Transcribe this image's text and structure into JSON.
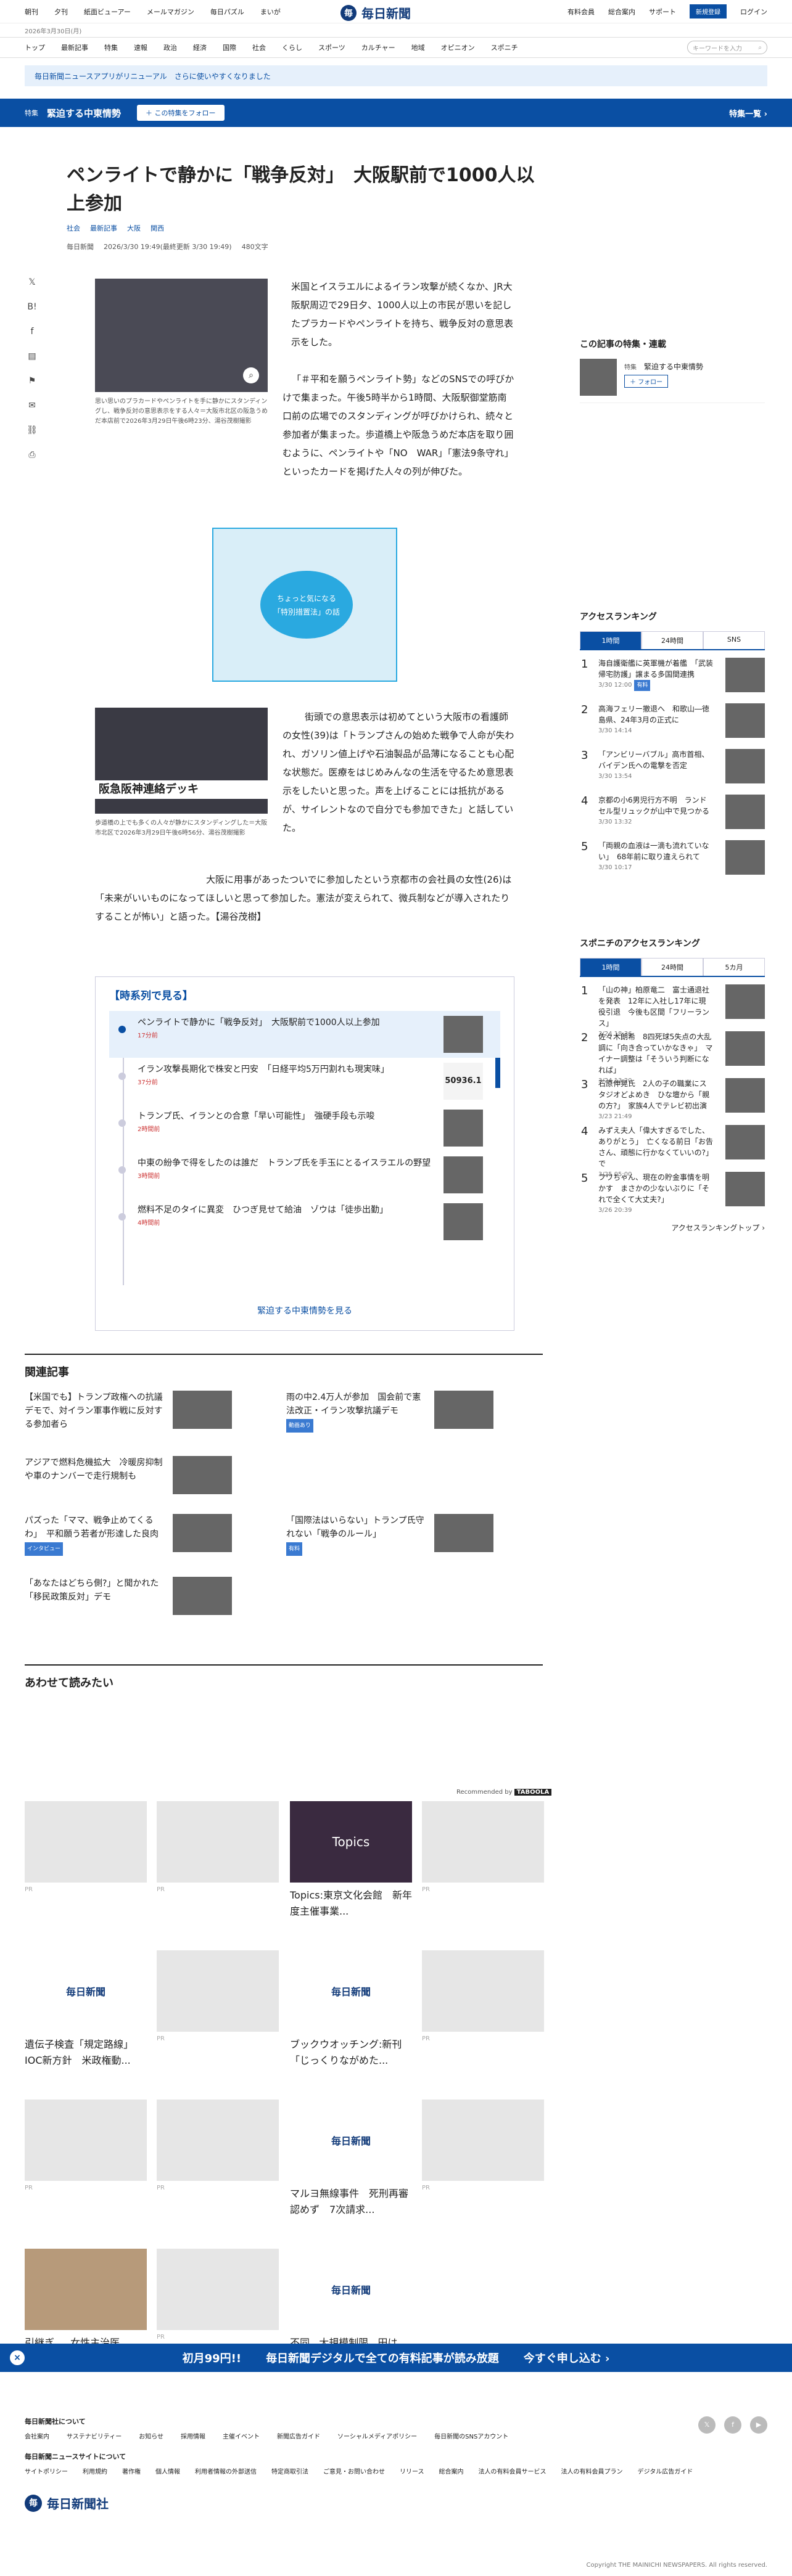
{
  "header": {
    "left_links": [
      "朝刊",
      "夕刊",
      "紙面ビューアー",
      "メールマガジン",
      "毎日パズル",
      "まいが"
    ],
    "logo_text": "毎日新聞",
    "right_links": [
      "有料会員",
      "総合案内",
      "サポート"
    ],
    "register_label": "新規登録",
    "login_label": "ログイン",
    "date": "2026年3月30日(月)"
  },
  "nav": {
    "items": [
      "トップ",
      "最新記事",
      "特集",
      "速報",
      "政治",
      "経済",
      "国際",
      "社会",
      "くらし",
      "スポーツ",
      "カルチャー",
      "地域",
      "オピニオン",
      "スポニチ"
    ],
    "search_placeholder": "キーワードを入力"
  },
  "notice": "毎日新聞ニュースアプリがリニューアル　さらに使いやすくなりました",
  "feature": {
    "tag": "特集",
    "title": "緊迫する中東情勢",
    "follow_label": "この特集をフォロー",
    "list_label": "特集一覧"
  },
  "article": {
    "title": "ペンライトで静かに「戦争反対」　大阪駅前で1000人以上参加",
    "tags": [
      "社会",
      "最新記事",
      "大阪",
      "関西"
    ],
    "author": "毎日新聞",
    "time": "2026/3/30 19:49(最終更新 3/30 19:49)",
    "length": "480文字",
    "caption1": "思い思いのプラカードやペンライトを手に静かにスタンディングし、戦争反対の意思表示をする人々＝大阪市北区の阪急うめだ本店前で2026年3月29日午後6時23分、湯谷茂樹撮影",
    "caption2": "歩道橋の上でも多くの人々が静かにスタンディングした＝大阪市北区で2026年3月29日午後6時56分、湯谷茂樹撮影",
    "p1": "米国とイスラエルによるイラン攻撃が続くなか、JR大阪駅周辺で29日夕、1000人以上の市民が思いを記したプラカードやペンライトを持ち、戦争反対の意思表示をした。",
    "p2": "「＃平和を願うペンライト勢」などのSNSでの呼びかけで集まった。午後5時半から1時間、大阪駅御堂筋南口前の広場でのスタンディングが呼びかけられ、続々と参加者が集まった。歩道橋上や阪急うめだ本店を取り囲むように、ペンライトや「NO　WAR」「憲法9条守れ」といったカードを掲げた人々の列が伸びた。",
    "p3": "街頭での意思表示は初めてという大阪市の看護師の女性(39)は「トランプさんの始めた戦争で人命が失われ、ガソリン値上げや石油製品が品薄になることも心配な状態だ。医療をはじめみんなの生活を守るため意思表示をしたいと思った。声を上げることには抵抗があるが、サイレントなので自分でも参加できた」と話していた。",
    "p4": "大阪に用事があったついでに参加したという京都市の会社員の女性(26)は「未来がいいものになってほしいと思って参加した。憲法が変えられて、微兵制などが導入されたりすることが怖い」と語った。【湯谷茂樹】",
    "promo_lines": [
      "ちょっと気になる",
      "「特別措置法」の話"
    ],
    "photo_sign": "阪急阪神連絡デッキ"
  },
  "timeline": {
    "title": "【時系列で見る】",
    "items": [
      {
        "title": "ペンライトで静かに「戦争反対」　大阪駅前で1000人以上参加",
        "date": "17分前"
      },
      {
        "title": "イラン攻撃長期化で株安と円安　「日経平均5万円割れも現実味」",
        "date": "37分前"
      },
      {
        "title": "トランプ氏、イランとの合意「早い可能性」　強硬手段も示唆",
        "date": "2時間前"
      },
      {
        "title": "中東の紛争で得をしたのは誰だ　トランプ氏を手玉にとるイスラエルの野望",
        "date": "3時間前"
      },
      {
        "title": "燃料不足のタイに異変　ひつぎ見せて給油　ゾウは「徒歩出勤」",
        "date": "4時間前"
      }
    ],
    "thumb_text": "50936.1",
    "more": "緊迫する中東情勢を見る"
  },
  "related": {
    "title": "関連記事",
    "items": [
      {
        "title": "【米国でも】トランプ政権への抗議デモで、対イラン軍事作戦に反対する参加者ら"
      },
      {
        "title": "雨の中2.4万人が参加　国会前で憲法改正・イラン攻撃抗議デモ",
        "badge": "動画あり"
      },
      {
        "title": "アジアで燃料危機拡大　冷暖房抑制や車のナンバーで走行規制も"
      },
      {
        "title": "パズった「ママ、戦争止めてくるわ」　平和願う若者が形達した良肉",
        "badge": "インタビュー"
      },
      {
        "title": "「国際法はいらない」トランプ氏守れない「戦争のルール」",
        "badge": "有料"
      },
      {
        "title": "「あなたはどちら側?」と聞かれた「移民政策反対」デモ"
      }
    ]
  },
  "recommend": {
    "title": "あわせて読みたい",
    "by": "Recommended by",
    "brand": "TABOOLA",
    "pr": "PR",
    "topics_label": "Topics",
    "cards": [
      "Topics:東京文化会館　新年度主催事業...",
      "遺伝子検査「規定路線」IOC新方針　米政権動...",
      "ブックウオッチング:新刊　「じっくりながめた...",
      "マルヨ無線事件　死刑再審認めず　7次請求...",
      "引継ぎ..　女性主治医...",
      "不同...大規模制限...田は..."
    ]
  },
  "sidebar": {
    "series_title": "この記事の特集・連載",
    "series_tag": "特集",
    "series_name": "緊迫する中東情勢",
    "series_follow": "フォロー",
    "access_title": "アクセスランキング",
    "tabs": [
      "1時間",
      "24時間",
      "SNS"
    ],
    "ranking": [
      {
        "title": "海自護衛艦に英軍機が着艦　「武装帰宅防護」譲まる多国間連携",
        "date": "3/30 12:00",
        "badge": "有料"
      },
      {
        "title": "高海フェリー撤退へ　和歌山―徳島県、24年3月の正式に",
        "date": "3/30 14:14"
      },
      {
        "title": "「アンビリーバブル」高市首相、バイデン氏への電撃を否定",
        "date": "3/30 13:54"
      },
      {
        "title": "京都の小6男児行方不明　ランドセル型リュックが山中で見つかる",
        "date": "3/30 13:32"
      },
      {
        "title": "「両親の血液は一滴も流れていない」　68年前に取り違えられて",
        "date": "3/30 10:17"
      }
    ],
    "sponichi_title": "スポニチのアクセスランキング",
    "sponichi_tabs": [
      "1時間",
      "24時間",
      "5カ月"
    ],
    "sponichi": [
      {
        "title": "「山の神」柏原竜二　富士通退社を発表　12年に入社し17年に現役引退　今後も区間「フリーランス」",
        "date": "3/24 18:36"
      },
      {
        "title": "佐々木朗希　8四死球5失点の大乱調に「向き合っていかなきゃ」　マイナー調整は「そういう判断になれば」",
        "date": "3/24 13:20"
      },
      {
        "title": "石原伸晃氏　2人の子の職業にスタジオどよめき　ひな壇から「親の方?」　家族4人でテレビ初出演",
        "date": "3/23 21:49"
      },
      {
        "title": "みずえ夫人「偉大すぎるでした、ありがとう」　亡くなる前日「お告さん、頑態に行かなくていいの?」で",
        "date": "3/25 05:00"
      },
      {
        "title": "フワちゃん、現在の貯金事情を明かす　まさかの少ないぶりに「それで全くて大丈夫?」",
        "date": "3/26 20:39"
      }
    ],
    "more": "アクセスランキングトップ"
  },
  "promo": {
    "price": "初月99円!!",
    "text": "毎日新聞デジタルで全ての有料記事が読み放題",
    "cta": "今すぐ申し込む"
  },
  "footer": {
    "about": "毎日新聞社について",
    "links1": [
      "会社案内",
      "サステナビリティー",
      "お知らせ",
      "採用情報",
      "主催イベント",
      "新聞広告ガイド",
      "ソーシャルメディアポリシー",
      "毎日新聞のSNSアカウント"
    ],
    "site_about": "毎日新聞ニュースサイトについて",
    "links2": [
      "サイトポリシー",
      "利用規約",
      "著作権",
      "個人情報",
      "利用者情報の外部送信",
      "特定商取引法",
      "ご意見・お問い合わせ",
      "リリース",
      "総合案内",
      "法人の有料会員サービス",
      "法人の有料会員プラン",
      "デジタル広告ガイド"
    ],
    "company": "毎日新聞社",
    "copyright": "Copyright THE MAINICHI NEWSPAPERS. All rights reserved."
  },
  "colors": {
    "brand": "#0a4fa3"
  }
}
